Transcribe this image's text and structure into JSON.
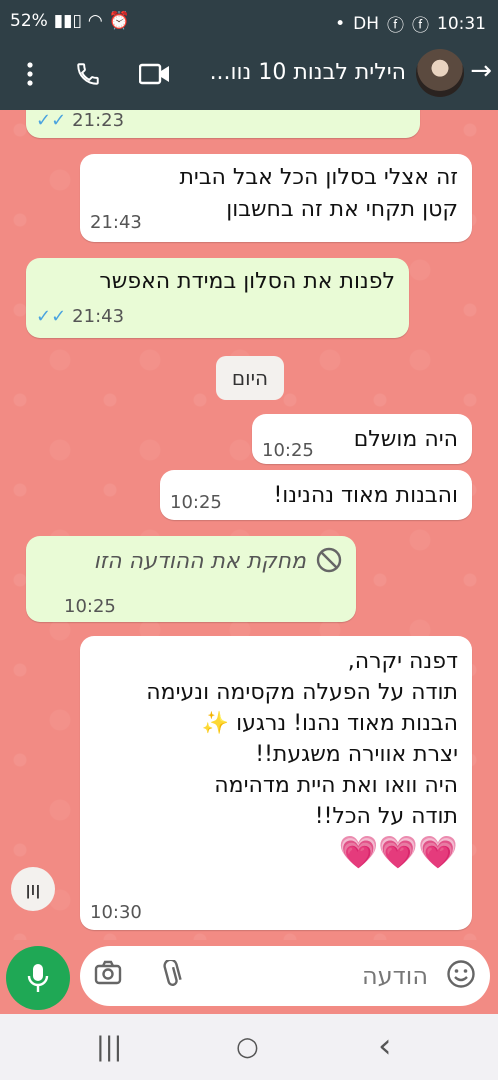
{
  "status": {
    "battery": "52%",
    "time": "10:31",
    "carrier_label": "DH"
  },
  "header": {
    "title": "הילית לבנות 10 נוו...",
    "back_icon": "arrow-right-icon",
    "icons": [
      "more-vert-icon",
      "phone-icon",
      "video-call-icon"
    ]
  },
  "messages": [
    {
      "type": "out",
      "text": "",
      "time": "21:23",
      "ticks": "✓✓"
    },
    {
      "type": "in",
      "text": "זה אצלי בסלון הכל אבל הבית קטן תקחי את זה בחשבון",
      "line1": "זה אצלי בסלון הכל אבל הבית",
      "line2": "קטן תקחי את זה בחשבון",
      "time": "21:43"
    },
    {
      "type": "out",
      "text": "לפנות את הסלון במידת האפשר",
      "time": "21:43",
      "ticks": "✓✓"
    },
    {
      "type": "day",
      "text": "היום"
    },
    {
      "type": "in",
      "text": "היה מושלם",
      "time": "10:25"
    },
    {
      "type": "in",
      "text": "והבנות מאוד נהנינו!",
      "time": "10:25"
    },
    {
      "type": "out",
      "text": "מחקת את ההודעה הזו",
      "time": "10:25",
      "deleted": true
    },
    {
      "type": "in",
      "lines": [
        "דפנה יקרה,",
        "תודה על הפעלה מקסימה ונעימה",
        "הבנות מאוד נהנו! נרגעו ✨",
        "יצרת אווירה משגעת!!",
        "היה וואו ואת היית מדהימה",
        "תודה על הכל!!",
        "💗💗💗"
      ],
      "time": "10:30"
    }
  ],
  "scroll_button": {
    "label": "ןון"
  },
  "input": {
    "placeholder": "הודעה"
  },
  "nav": {
    "back": "‹",
    "home": "○",
    "recents": "|||"
  }
}
